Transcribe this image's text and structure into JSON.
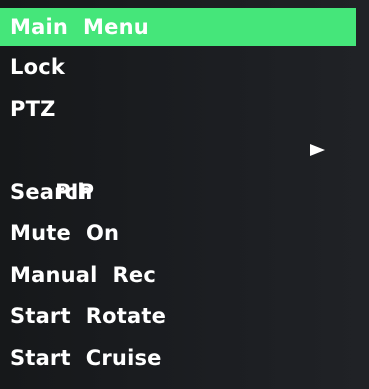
{
  "menu": {
    "items": [
      {
        "label": "Main  Menu",
        "selected": true
      },
      {
        "label": "Lock"
      },
      {
        "label": "PTZ"
      },
      {
        "label": "PIP",
        "submenu_icon": "right-triangle-icon"
      },
      {
        "label": "Search"
      },
      {
        "label": "Mute  On"
      },
      {
        "label": "Manual  Rec"
      },
      {
        "label": "Start  Rotate"
      },
      {
        "label": "Start  Cruise"
      }
    ]
  },
  "colors": {
    "highlight": "#45e67a",
    "text": "#ffffff",
    "background": "#1c1e22"
  }
}
